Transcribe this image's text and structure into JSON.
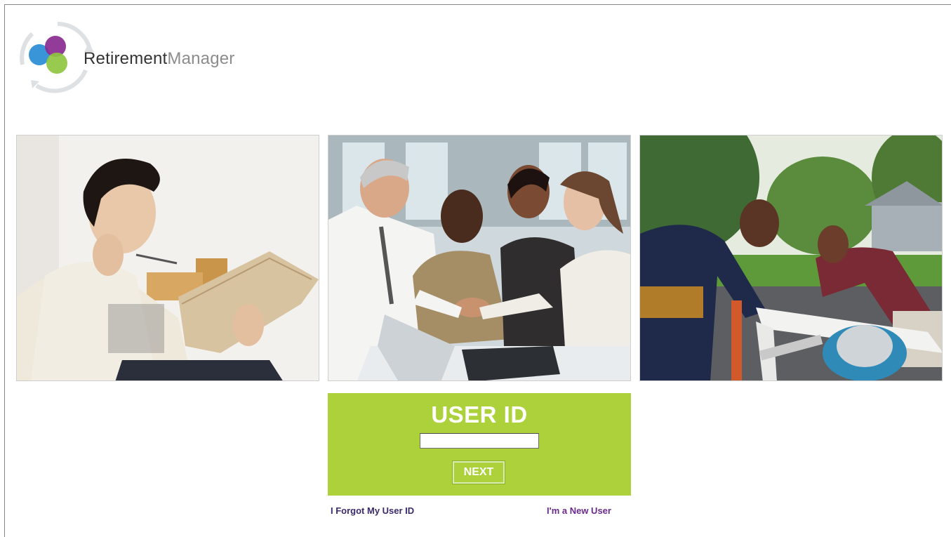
{
  "brand": {
    "name_part1": "Retirement",
    "name_part2": "Manager",
    "colors": {
      "blue": "#2f8fd6",
      "purple": "#8a2a90",
      "green": "#8ec63f",
      "ring": "#d9dde0"
    }
  },
  "photos": [
    {
      "description_icon": "woman-reading-newspaper-photo"
    },
    {
      "description_icon": "business-handshake-photo"
    },
    {
      "description_icon": "men-building-outdoors-photo"
    }
  ],
  "login": {
    "title": "USER ID",
    "input_value": "",
    "input_placeholder": "",
    "next_label": "NEXT",
    "panel_color": "#acd13b"
  },
  "links": {
    "forgot": "I Forgot My User ID",
    "new_user": "I'm a New User"
  }
}
